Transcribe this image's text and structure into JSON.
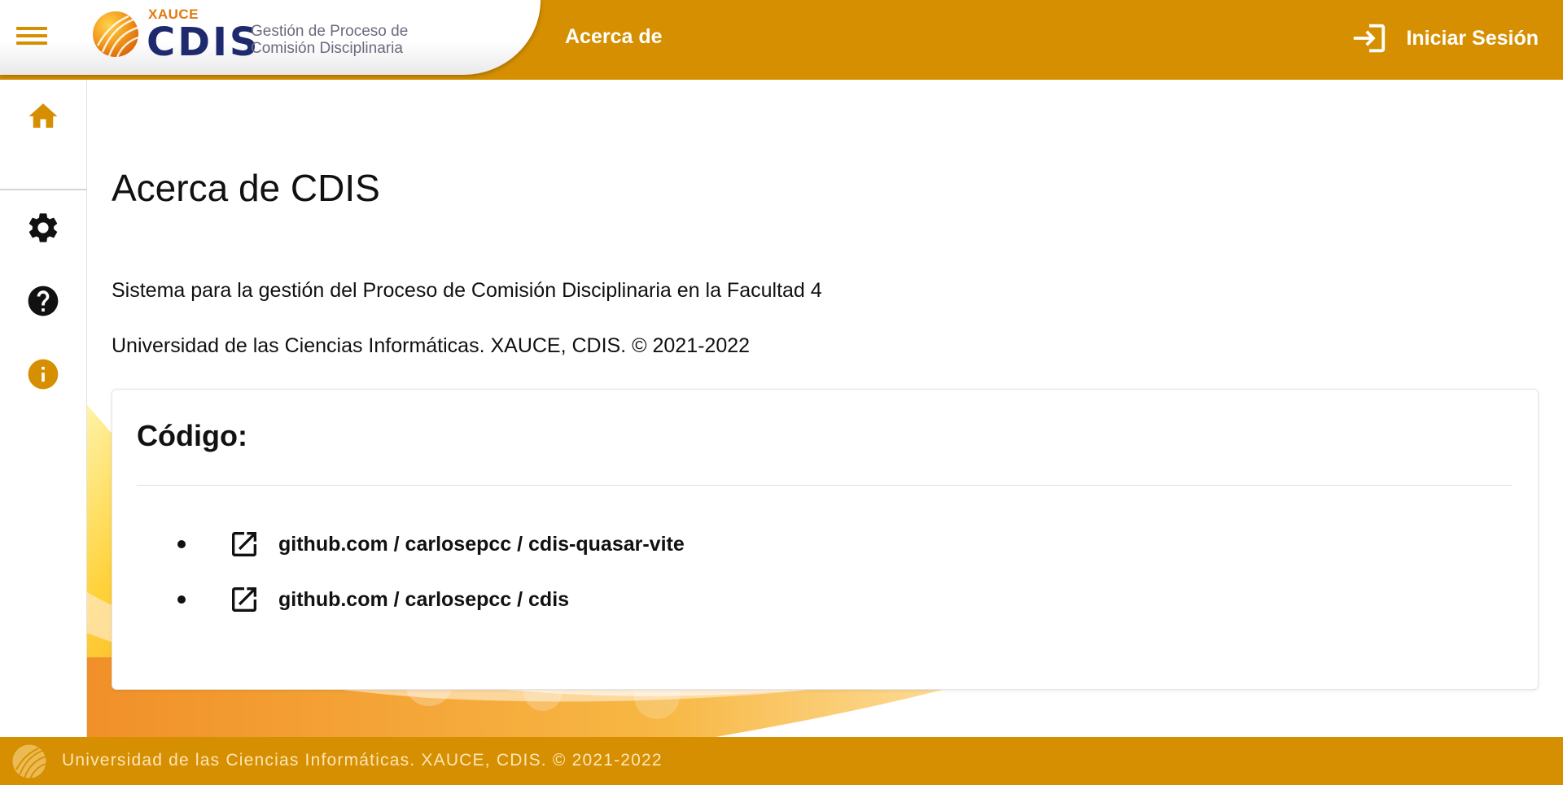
{
  "header": {
    "logo_top": "XAUCE",
    "logo_main": "CDIS",
    "logo_sub_line1": "Gestión de Proceso de",
    "logo_sub_line2": "Comisión Disciplinaria",
    "nav_title": "Acerca de",
    "login_label": "Iniciar Sesión",
    "login_icon": "login-icon",
    "menu_icon": "menu-icon"
  },
  "sidebar": {
    "items": [
      {
        "name": "home",
        "icon": "home-icon",
        "color": "#d68f00"
      },
      {
        "name": "settings",
        "icon": "gear-icon",
        "color": "#111111"
      },
      {
        "name": "help",
        "icon": "help-icon",
        "color": "#111111"
      },
      {
        "name": "about",
        "icon": "info-icon",
        "color": "#d68f00"
      }
    ]
  },
  "main": {
    "title": "Acerca de CDIS",
    "description": "Sistema para la gestión del Proceso de Comisión Disciplinaria en la Facultad 4",
    "copyright": "Universidad de las Ciencias Informáticas. XAUCE, CDIS. © 2021-2022",
    "code_card": {
      "title": "Código:",
      "links": [
        {
          "label": "github.com / carlosepcc / cdis-quasar-vite",
          "icon": "open-in-new-icon"
        },
        {
          "label": "github.com / carlosepcc / cdis",
          "icon": "open-in-new-icon"
        }
      ]
    }
  },
  "footer": {
    "text": "Universidad de las Ciencias Informáticas. XAUCE, CDIS. © 2021-2022"
  },
  "colors": {
    "accent": "#d68f00",
    "brand_navy": "#1f2a6e",
    "text": "#111111"
  }
}
